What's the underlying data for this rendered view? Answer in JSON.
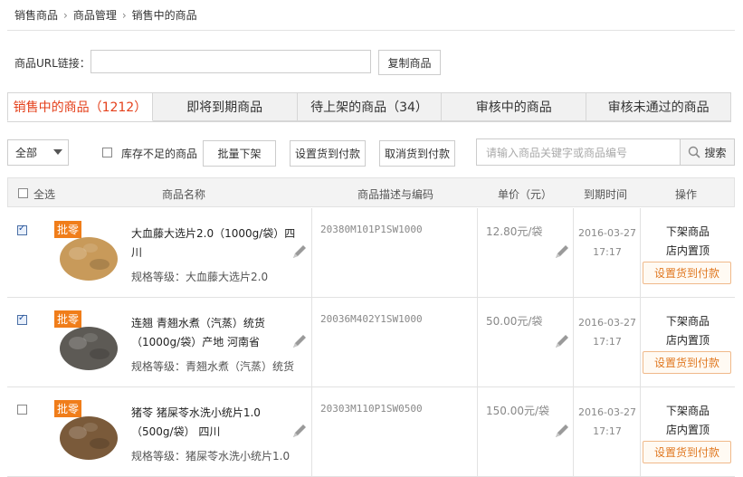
{
  "breadcrumb": [
    "销售商品",
    "商品管理",
    "销售中的商品"
  ],
  "url_section": {
    "label": "商品URL链接：",
    "value": "",
    "copy_button": "复制商品"
  },
  "tabs": [
    {
      "label": "销售中的商品（1212）",
      "active": true
    },
    {
      "label": "即将到期商品",
      "active": false
    },
    {
      "label": "待上架的商品（34）",
      "active": false
    },
    {
      "label": "审核中的商品",
      "active": false
    },
    {
      "label": "审核未通过的商品",
      "active": false
    }
  ],
  "toolbar": {
    "filter_value": "全部",
    "low_stock_label": "库存不足的商品",
    "batch_unlist": "批量下架",
    "set_cod": "设置货到付款",
    "cancel_cod": "取消货到付款",
    "search_placeholder": "请输入商品关键字或商品编号",
    "search_button": "搜索"
  },
  "table": {
    "headers": {
      "select_all": "全选",
      "name": "商品名称",
      "desc": "商品描述与编码",
      "price": "单价（元）",
      "expire": "到期时间",
      "ops": "操作"
    },
    "rows": [
      {
        "checked": true,
        "tag": "批零",
        "name": "大血藤大选片2.0（1000g/袋）四川",
        "spec": "规格等级：大血藤大选片2.0",
        "code": "20380M101P1SW1000",
        "price": "12.80元/袋",
        "date": "2016-03-27",
        "time": "17:17",
        "op1": "下架商品",
        "op2": "店内置顶",
        "op3": "设置货到付款",
        "thumb_color": "#c89a5a"
      },
      {
        "checked": true,
        "tag": "批零",
        "name": "连翘 青翘水煮（汽蒸）统货 （1000g/袋）产地 河南省",
        "spec": "规格等级：青翘水煮（汽蒸）统货",
        "code": "20036M402Y1SW1000",
        "price": "50.00元/袋",
        "date": "2016-03-27",
        "time": "17:17",
        "op1": "下架商品",
        "op2": "店内置顶",
        "op3": "设置货到付款",
        "thumb_color": "#5d5a55"
      },
      {
        "checked": false,
        "tag": "批零",
        "name": "猪苓 猪屎苓水洗小统片1.0 （500g/袋） 四川",
        "spec": "规格等级：猪屎苓水洗小统片1.0",
        "code": "20303M110P1SW0500",
        "price": "150.00元/袋",
        "date": "2016-03-27",
        "time": "17:17",
        "op1": "下架商品",
        "op2": "店内置顶",
        "op3": "设置货到付款",
        "thumb_color": "#7a5a3a"
      }
    ]
  }
}
